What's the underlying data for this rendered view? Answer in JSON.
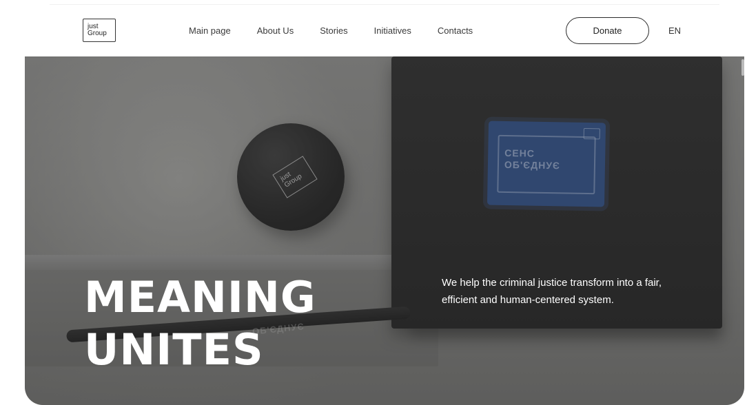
{
  "header": {
    "logo_line1": "just",
    "logo_line2": "Group",
    "nav": [
      {
        "label": "Main page"
      },
      {
        "label": "About Us"
      },
      {
        "label": "Stories"
      },
      {
        "label": "Initiatives"
      },
      {
        "label": "Contacts"
      }
    ],
    "donate_label": "Donate",
    "language": "EN"
  },
  "hero": {
    "headline_line1": "MEANING",
    "headline_line2": "UNITES",
    "tagline": "We help the criminal justice transform into a fair, efficient and human-centered system.",
    "sticker_line1": "СЕНС",
    "sticker_line2": "ОБ'ЄДНУЄ",
    "ball_logo_line1": "just",
    "ball_logo_line2": "Group",
    "pen_text": "ОБ'ЄДНУЄ"
  },
  "colors": {
    "background": "#ffffff",
    "text_dark": "#333333",
    "hero_text": "#ffffff",
    "sticker_blue": "#2b4d86"
  }
}
